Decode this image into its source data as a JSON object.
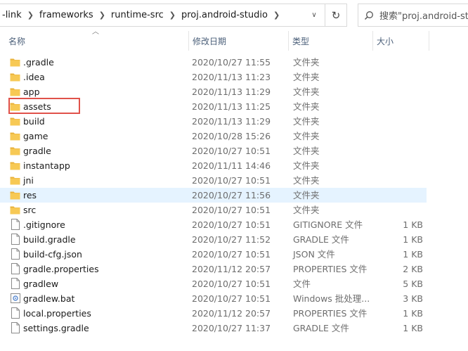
{
  "address": {
    "crumbs": [
      "-link",
      "frameworks",
      "runtime-src",
      "proj.android-studio"
    ],
    "search_placeholder": "搜索\"proj.android-stu"
  },
  "columns": {
    "name": "名称",
    "date": "修改日期",
    "type": "类型",
    "size": "大小"
  },
  "files": [
    {
      "name": ".gradle",
      "date": "2020/10/27 11:55",
      "type": "文件夹",
      "size": "",
      "kind": "folder"
    },
    {
      "name": ".idea",
      "date": "2020/11/13 11:23",
      "type": "文件夹",
      "size": "",
      "kind": "folder"
    },
    {
      "name": "app",
      "date": "2020/11/13 11:29",
      "type": "文件夹",
      "size": "",
      "kind": "folder"
    },
    {
      "name": "assets",
      "date": "2020/11/13 11:25",
      "type": "文件夹",
      "size": "",
      "kind": "folder"
    },
    {
      "name": "build",
      "date": "2020/11/13 11:29",
      "type": "文件夹",
      "size": "",
      "kind": "folder"
    },
    {
      "name": "game",
      "date": "2020/10/28 15:26",
      "type": "文件夹",
      "size": "",
      "kind": "folder"
    },
    {
      "name": "gradle",
      "date": "2020/10/27 10:51",
      "type": "文件夹",
      "size": "",
      "kind": "folder"
    },
    {
      "name": "instantapp",
      "date": "2020/11/11 14:46",
      "type": "文件夹",
      "size": "",
      "kind": "folder"
    },
    {
      "name": "jni",
      "date": "2020/10/27 10:51",
      "type": "文件夹",
      "size": "",
      "kind": "folder"
    },
    {
      "name": "res",
      "date": "2020/10/27 11:56",
      "type": "文件夹",
      "size": "",
      "kind": "folder"
    },
    {
      "name": "src",
      "date": "2020/10/27 10:51",
      "type": "文件夹",
      "size": "",
      "kind": "folder"
    },
    {
      "name": ".gitignore",
      "date": "2020/10/27 10:51",
      "type": "GITIGNORE 文件",
      "size": "1 KB",
      "kind": "file"
    },
    {
      "name": "build.gradle",
      "date": "2020/10/27 11:52",
      "type": "GRADLE 文件",
      "size": "1 KB",
      "kind": "file"
    },
    {
      "name": "build-cfg.json",
      "date": "2020/10/27 10:51",
      "type": "JSON 文件",
      "size": "1 KB",
      "kind": "file"
    },
    {
      "name": "gradle.properties",
      "date": "2020/11/12 20:57",
      "type": "PROPERTIES 文件",
      "size": "2 KB",
      "kind": "file"
    },
    {
      "name": "gradlew",
      "date": "2020/10/27 10:51",
      "type": "文件",
      "size": "5 KB",
      "kind": "file"
    },
    {
      "name": "gradlew.bat",
      "date": "2020/10/27 10:51",
      "type": "Windows 批处理...",
      "size": "3 KB",
      "kind": "bat"
    },
    {
      "name": "local.properties",
      "date": "2020/11/12 20:57",
      "type": "PROPERTIES 文件",
      "size": "1 KB",
      "kind": "file"
    },
    {
      "name": "settings.gradle",
      "date": "2020/10/27 11:37",
      "type": "GRADLE 文件",
      "size": "1 KB",
      "kind": "file"
    }
  ],
  "hover_index": 9,
  "highlight_index": 3,
  "colors": {
    "folder": "#f7c955",
    "folder_dark": "#e8b13a",
    "hover": "#e5f3ff",
    "highlight": "#e0524a",
    "header_text": "#4c607a"
  }
}
